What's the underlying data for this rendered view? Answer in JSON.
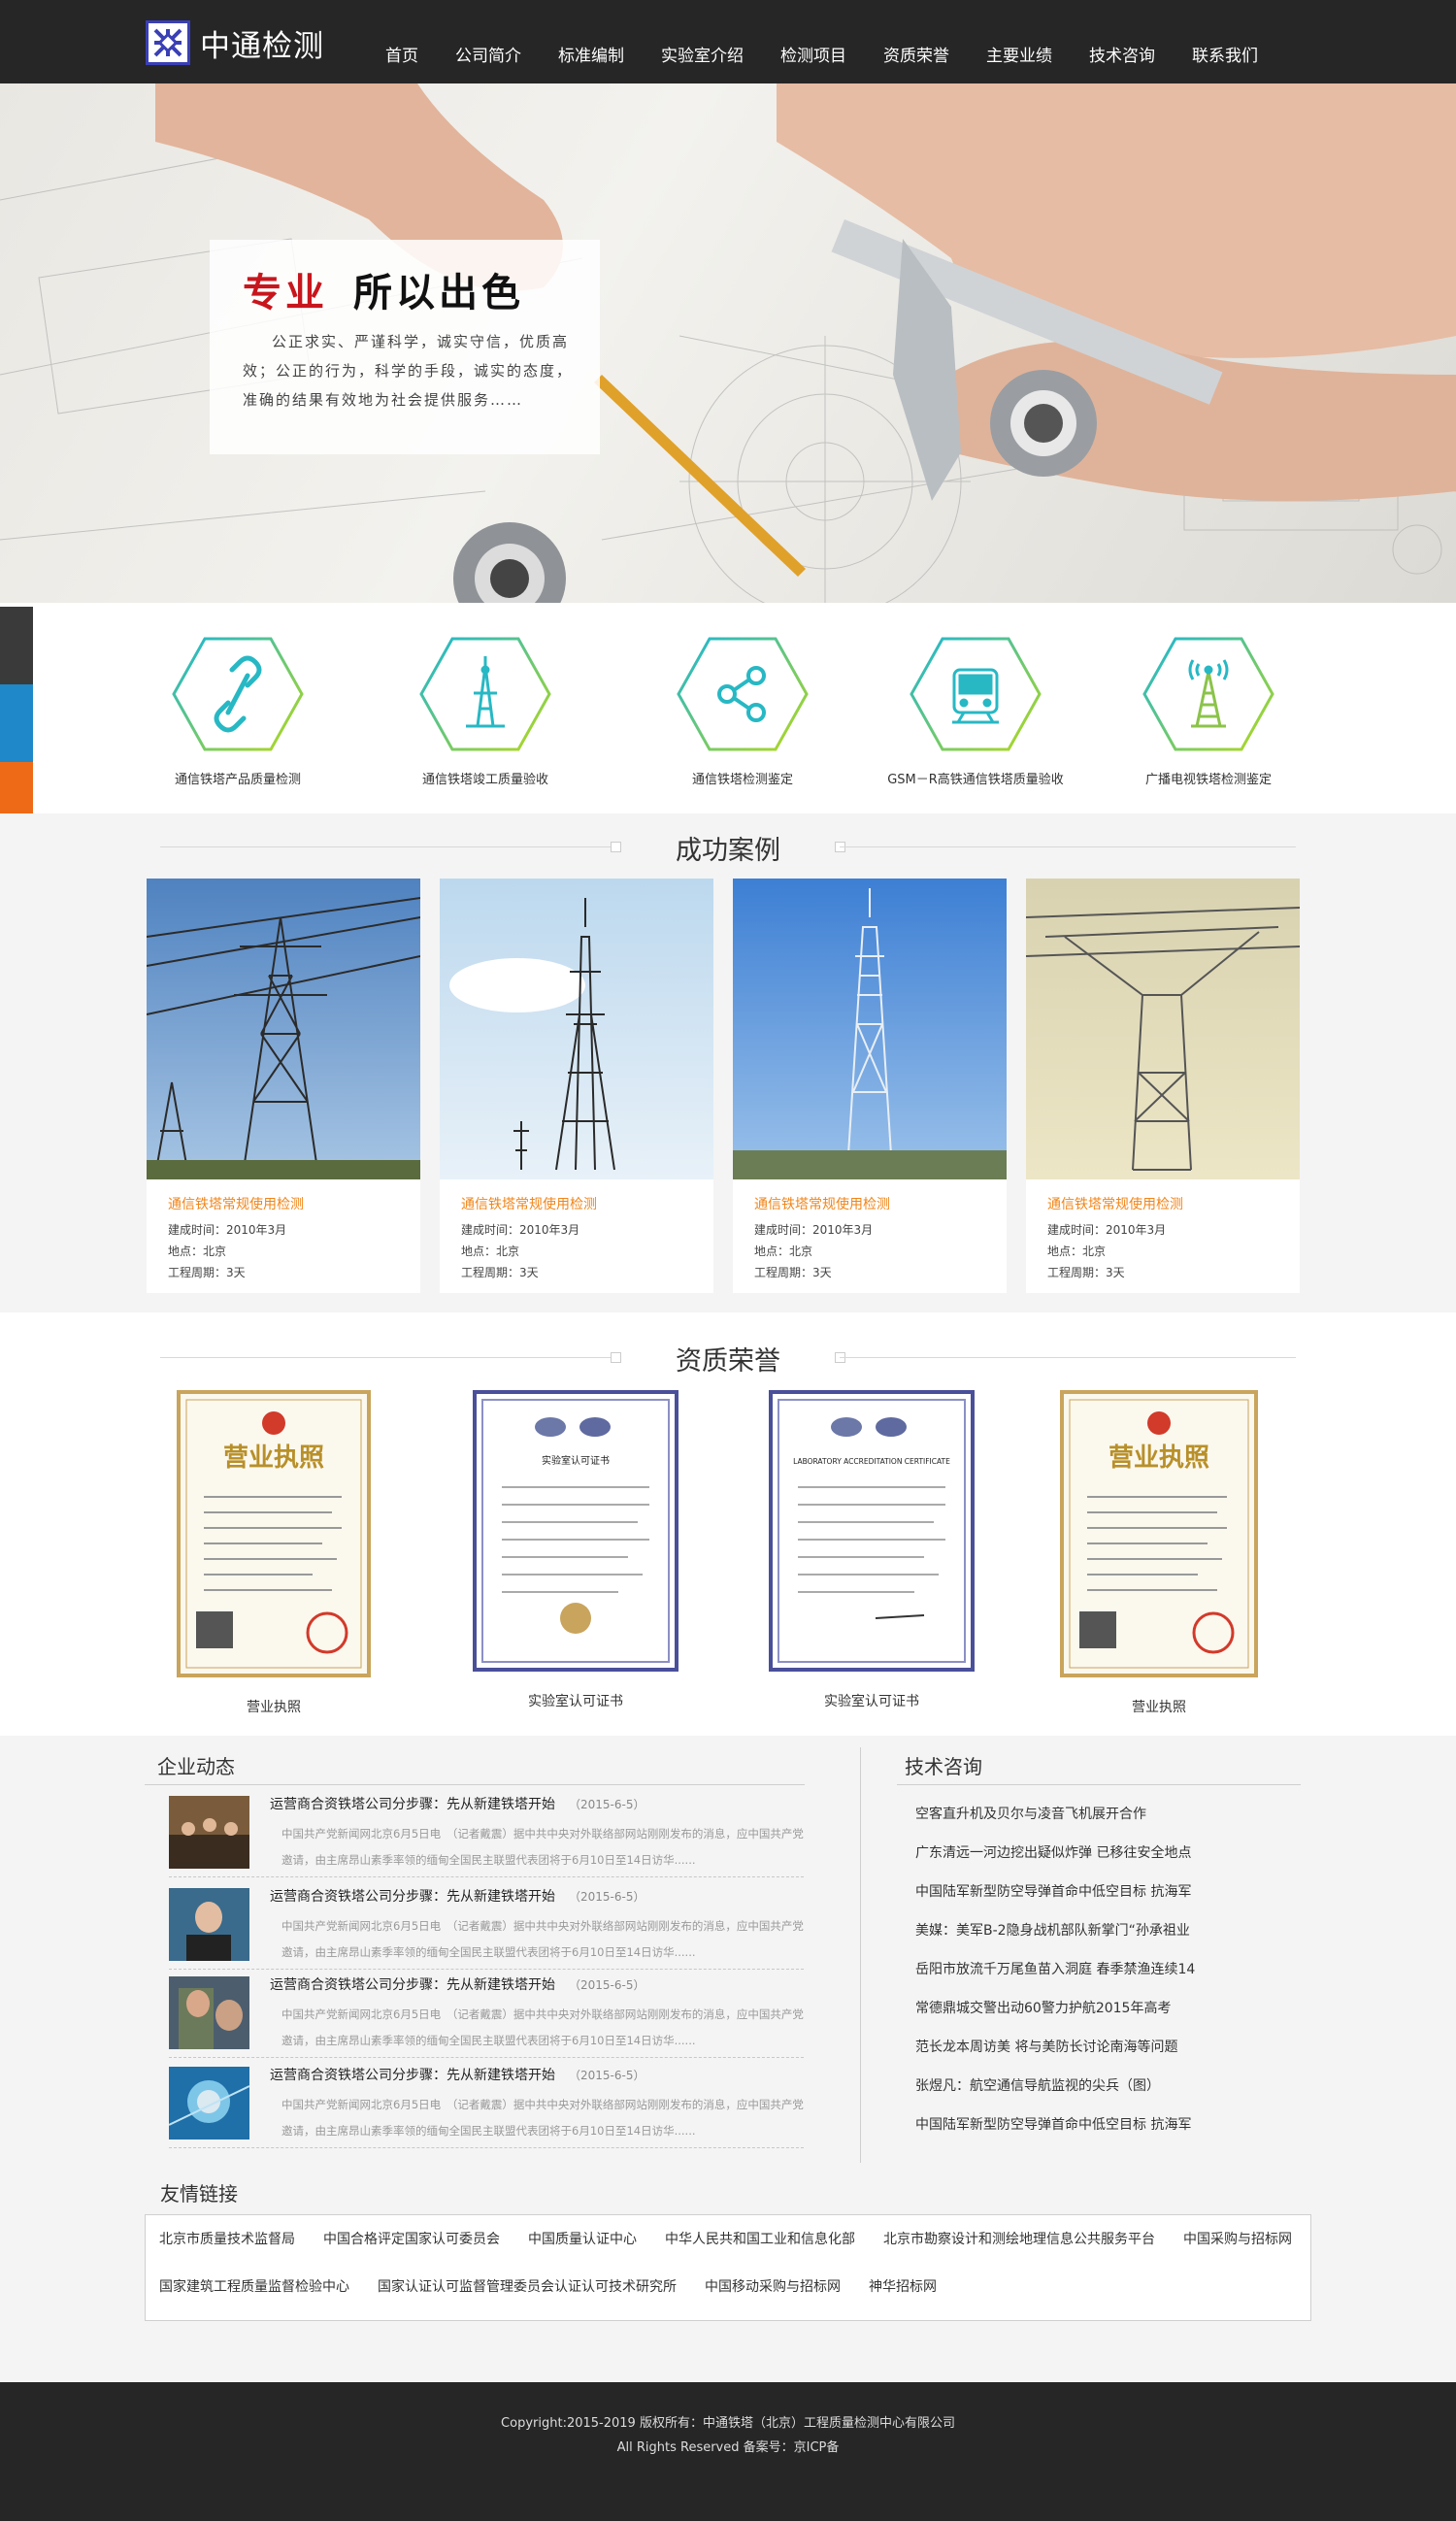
{
  "header": {
    "logo_text": "中通检测",
    "nav": [
      "首页",
      "公司简介",
      "标准编制",
      "实验室介绍",
      "检测项目",
      "资质荣誉",
      "主要业绩",
      "技术咨询",
      "联系我们"
    ]
  },
  "banner": {
    "slogan_red": "专业",
    "slogan_black": "所以出色",
    "description": "公正求实、严谨科学，诚实守信，优质高效；公正的行为，科学的手段，诚实的态度，准确的结果有效地为社会提供服务……"
  },
  "side_tabs": {
    "colors": [
      "#3a3a3a",
      "#1e88c9",
      "#ef6a17"
    ]
  },
  "services": [
    {
      "label": "通信铁塔产品质量检测",
      "icon": "link-icon"
    },
    {
      "label": "通信铁塔竣工质量验收",
      "icon": "tower-icon"
    },
    {
      "label": "通信铁塔检测鉴定",
      "icon": "share-icon"
    },
    {
      "label": "GSM－R高铁通信铁塔质量验收",
      "icon": "train-icon"
    },
    {
      "label": "广播电视铁塔检测鉴定",
      "icon": "broadcast-tower-icon"
    }
  ],
  "cases": {
    "title": "成功案例",
    "items": [
      {
        "title": "通信铁塔常规使用检测",
        "built": "建成时间：2010年3月",
        "place": "地点：北京",
        "period": "工程周期：3天"
      },
      {
        "title": "通信铁塔常规使用检测",
        "built": "建成时间：2010年3月",
        "place": "地点：北京",
        "period": "工程周期：3天"
      },
      {
        "title": "通信铁塔常规使用检测",
        "built": "建成时间：2010年3月",
        "place": "地点：北京",
        "period": "工程周期：3天"
      },
      {
        "title": "通信铁塔常规使用检测",
        "built": "建成时间：2010年3月",
        "place": "地点：北京",
        "period": "工程周期：3天"
      }
    ]
  },
  "honors": {
    "title": "资质荣誉",
    "items": [
      {
        "label": "营业执照",
        "seal": "营业执照"
      },
      {
        "label": "实验室认可证书",
        "seal": "实验室认可证书"
      },
      {
        "label": "实验室认可证书",
        "seal": "LABORATORY ACCREDITATION CERTIFICATE"
      },
      {
        "label": "营业执照",
        "seal": "营业执照"
      }
    ]
  },
  "news": {
    "heading": "企业动态",
    "items": [
      {
        "title": "运营商合资铁塔公司分步骤：先从新建铁塔开始",
        "date": "（2015-6-5）",
        "summary": "中国共产党新闻网北京6月5日电　（记者戴震）据中共中央对外联络部网站刚刚发布的消息，应中国共产党邀请，由主席昂山素季率领的缅甸全国民主联盟代表团将于6月10日至14日访华......"
      },
      {
        "title": "运营商合资铁塔公司分步骤：先从新建铁塔开始",
        "date": "（2015-6-5）",
        "summary": "中国共产党新闻网北京6月5日电　（记者戴震）据中共中央对外联络部网站刚刚发布的消息，应中国共产党邀请，由主席昂山素季率领的缅甸全国民主联盟代表团将于6月10日至14日访华......"
      },
      {
        "title": "运营商合资铁塔公司分步骤：先从新建铁塔开始",
        "date": "（2015-6-5）",
        "summary": "中国共产党新闻网北京6月5日电　（记者戴震）据中共中央对外联络部网站刚刚发布的消息，应中国共产党邀请，由主席昂山素季率领的缅甸全国民主联盟代表团将于6月10日至14日访华......"
      },
      {
        "title": "运营商合资铁塔公司分步骤：先从新建铁塔开始",
        "date": "（2015-6-5）",
        "summary": "中国共产党新闻网北京6月5日电　（记者戴震）据中共中央对外联络部网站刚刚发布的消息，应中国共产党邀请，由主席昂山素季率领的缅甸全国民主联盟代表团将于6月10日至14日访华......"
      }
    ]
  },
  "tech": {
    "heading": "技术咨询",
    "items": [
      "空客直升机及贝尔与凌音飞机展开合作",
      "广东清远一河边挖出疑似炸弹 已移往安全地点",
      "中国陆军新型防空导弹首命中低空目标 抗海军",
      "美媒：美军B-2隐身战机部队新掌门“孙承祖业",
      "岳阳市放流千万尾鱼苗入洞庭 春季禁渔连续14",
      "常德鼎城交警出动60警力护航2015年高考",
      "范长龙本周访美 将与美防长讨论南海等问题",
      "张煜凡：航空通信导航监视的尖兵（图）",
      "中国陆军新型防空导弹首命中低空目标 抗海军"
    ]
  },
  "links": {
    "heading": "友情链接",
    "row1": [
      "北京市质量技术监督局",
      "中国合格评定国家认可委员会",
      "中国质量认证中心",
      "中华人民共和国工业和信息化部",
      "北京市勘察设计和测绘地理信息公共服务平台",
      "中国采购与招标网"
    ],
    "row2": [
      "国家建筑工程质量监督检验中心",
      "国家认证认可监督管理委员会认证认可技术研究所",
      "中国移动采购与招标网",
      "神华招标网"
    ]
  },
  "footer": {
    "copyright": "Copyright:2015-2019 版权所有：中通铁塔（北京）工程质量检测中心有限公司",
    "rights": "All Rights Reserved 备案号：京ICP备"
  }
}
